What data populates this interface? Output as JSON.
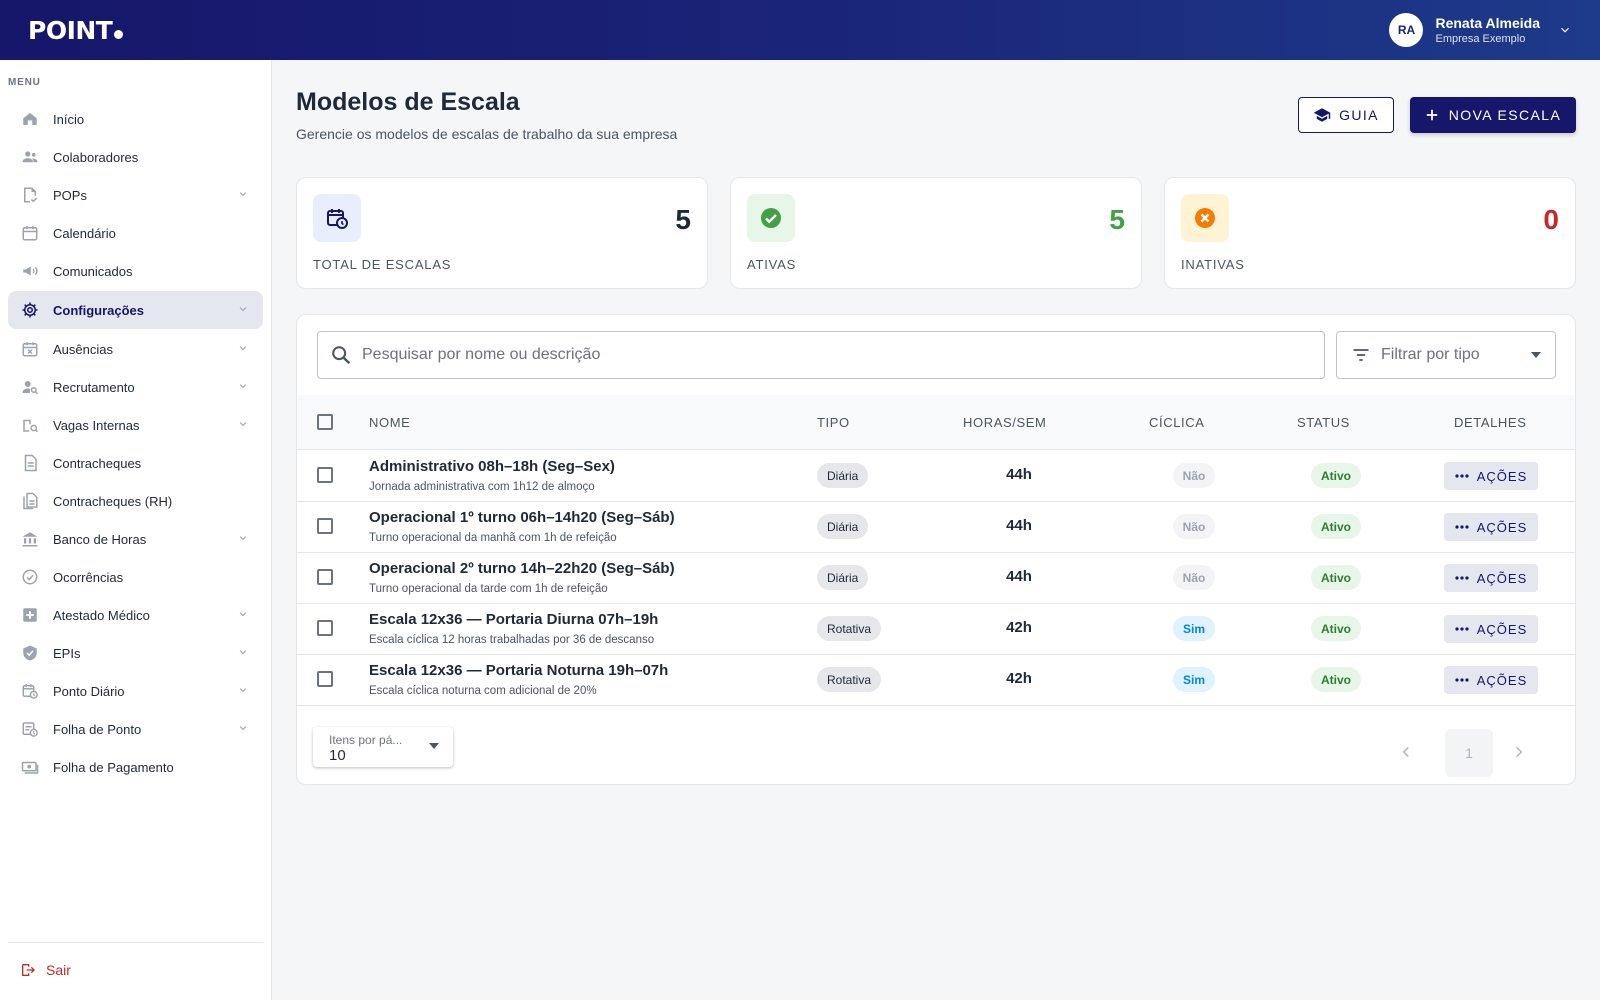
{
  "app": {
    "logo": "POINT",
    "user": {
      "initials": "RA",
      "name": "Renata Almeida",
      "company": "Empresa Exemplo"
    }
  },
  "sidebar": {
    "menu_label": "MENU",
    "items": [
      {
        "label": "Início",
        "icon": "home-icon",
        "expandable": false
      },
      {
        "label": "Colaboradores",
        "icon": "people-icon",
        "expandable": false
      },
      {
        "label": "POPs",
        "icon": "document-check-icon",
        "expandable": true
      },
      {
        "label": "Calendário",
        "icon": "calendar-icon",
        "expandable": false
      },
      {
        "label": "Comunicados",
        "icon": "megaphone-icon",
        "expandable": false
      },
      {
        "label": "Configurações",
        "icon": "gear-icon",
        "expandable": true,
        "active": true
      },
      {
        "label": "Ausências",
        "icon": "calendar-x-icon",
        "expandable": true
      },
      {
        "label": "Recrutamento",
        "icon": "person-search-icon",
        "expandable": true
      },
      {
        "label": "Vagas Internas",
        "icon": "building-search-icon",
        "expandable": true
      },
      {
        "label": "Contracheques",
        "icon": "document-icon",
        "expandable": false
      },
      {
        "label": "Contracheques (RH)",
        "icon": "documents-icon",
        "expandable": false
      },
      {
        "label": "Banco de Horas",
        "icon": "bank-icon",
        "expandable": true
      },
      {
        "label": "Ocorrências",
        "icon": "check-circle-icon",
        "expandable": false
      },
      {
        "label": "Atestado Médico",
        "icon": "medical-plus-icon",
        "expandable": true
      },
      {
        "label": "EPIs",
        "icon": "shield-check-icon",
        "expandable": true
      },
      {
        "label": "Ponto Diário",
        "icon": "calendar-clock-icon",
        "expandable": true
      },
      {
        "label": "Folha de Ponto",
        "icon": "sheet-clock-icon",
        "expandable": true
      },
      {
        "label": "Folha de Pagamento",
        "icon": "money-icon",
        "expandable": false
      }
    ],
    "logout_label": "Sair"
  },
  "header": {
    "title": "Modelos de Escala",
    "subtitle": "Gerencie os modelos de escalas de trabalho da sua empresa",
    "guide_label": "GUIA",
    "new_label": "NOVA ESCALA"
  },
  "stats": [
    {
      "label": "TOTAL DE ESCALAS",
      "value": "5",
      "color": "#1f2937",
      "icon": "calendar-clock-icon",
      "icon_bg": "#e8eefc",
      "icon_color": "#16166a"
    },
    {
      "label": "ATIVAS",
      "value": "5",
      "color": "#43a047",
      "icon": "check-circle-icon",
      "icon_bg": "#e8f5e9",
      "icon_color": "#43a047"
    },
    {
      "label": "INATIVAS",
      "value": "0",
      "color": "#c62828",
      "icon": "close-circle-icon",
      "icon_bg": "#fff3d6",
      "icon_color": "#f57c00"
    }
  ],
  "search": {
    "placeholder": "Pesquisar por nome ou descrição"
  },
  "filter": {
    "placeholder": "Filtrar por tipo"
  },
  "table": {
    "columns": {
      "name": "NOME",
      "type": "TIPO",
      "hours": "HORAS/SEM",
      "cyclic": "CÍCLICA",
      "status": "STATUS",
      "details": "DETALHES"
    },
    "actions_label": "AÇÕES",
    "rows": [
      {
        "name": "Administrativo 08h–18h (Seg–Sex)",
        "desc": "Jornada administrativa com 1h12 de almoço",
        "type": "Diária",
        "hours": "44h",
        "cyclic": "Não",
        "cyclic_yes": false,
        "status": "Ativo"
      },
      {
        "name": "Operacional 1º turno 06h–14h20 (Seg–Sáb)",
        "desc": "Turno operacional da manhã com 1h de refeição",
        "type": "Diária",
        "hours": "44h",
        "cyclic": "Não",
        "cyclic_yes": false,
        "status": "Ativo"
      },
      {
        "name": "Operacional 2º turno 14h–22h20 (Seg–Sáb)",
        "desc": "Turno operacional da tarde com 1h de refeição",
        "type": "Diária",
        "hours": "44h",
        "cyclic": "Não",
        "cyclic_yes": false,
        "status": "Ativo"
      },
      {
        "name": "Escala 12x36 — Portaria Diurna 07h–19h",
        "desc": "Escala cíclica 12 horas trabalhadas por 36 de descanso",
        "type": "Rotativa",
        "hours": "42h",
        "cyclic": "Sim",
        "cyclic_yes": true,
        "status": "Ativo"
      },
      {
        "name": "Escala 12x36 — Portaria Noturna 19h–07h",
        "desc": "Escala cíclica noturna com adicional de 20%",
        "type": "Rotativa",
        "hours": "42h",
        "cyclic": "Sim",
        "cyclic_yes": true,
        "status": "Ativo"
      }
    ]
  },
  "pagination": {
    "per_page_label": "Itens por pá...",
    "per_page_value": "10",
    "current_page": "1"
  }
}
